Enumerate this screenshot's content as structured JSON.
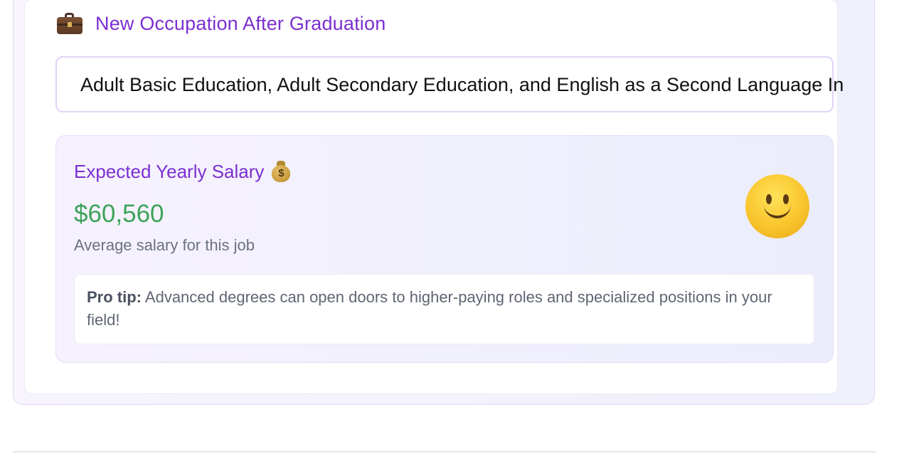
{
  "occupation_section": {
    "icon": "briefcase-icon",
    "title": "New Occupation After Graduation",
    "occupation_value": "Adult Basic Education, Adult Secondary Education, and English as a Second Language In"
  },
  "salary_section": {
    "title": "Expected Yearly Salary",
    "title_icon": "moneybag-icon",
    "amount": "$60,560",
    "caption": "Average salary for this job",
    "mood_icon": "smiley-icon",
    "tip_label": "Pro tip:",
    "tip_text": "Advanced degrees can open doors to higher-paying roles and specialized positions in your field!"
  },
  "colors": {
    "accent_purple": "#7b2fd0",
    "salary_green": "#3da35a"
  }
}
